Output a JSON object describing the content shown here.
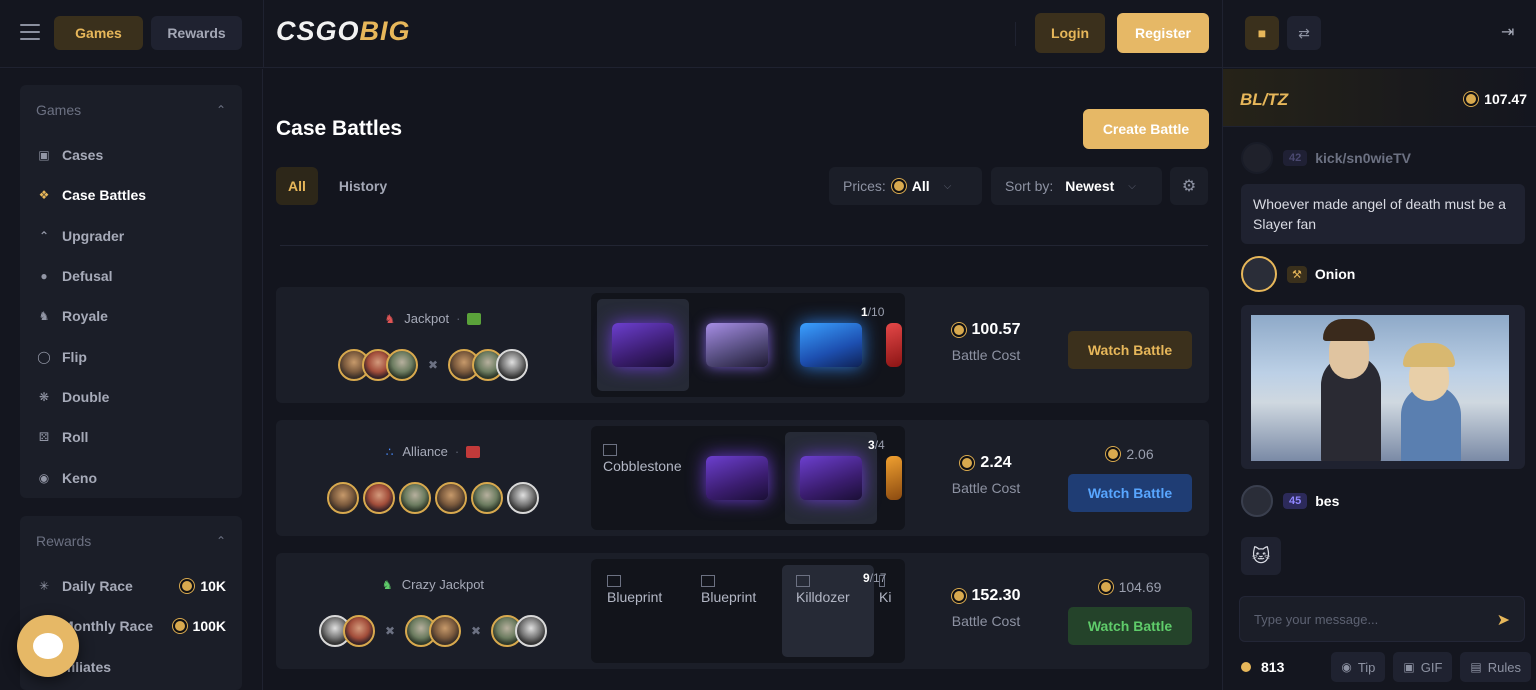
{
  "header": {
    "nav_games": "Games",
    "nav_rewards": "Rewards",
    "logo_main": "CSGO",
    "logo_accent": "BIG",
    "login": "Login",
    "register": "Register"
  },
  "sidebar": {
    "games_title": "Games",
    "games": [
      {
        "label": "Cases",
        "icon": "cases-icon"
      },
      {
        "label": "Case Battles",
        "icon": "case-battles-icon"
      },
      {
        "label": "Upgrader",
        "icon": "upgrader-icon"
      },
      {
        "label": "Defusal",
        "icon": "defusal-icon"
      },
      {
        "label": "Royale",
        "icon": "royale-icon"
      },
      {
        "label": "Flip",
        "icon": "flip-icon"
      },
      {
        "label": "Double",
        "icon": "double-icon"
      },
      {
        "label": "Roll",
        "icon": "roll-icon"
      },
      {
        "label": "Keno",
        "icon": "keno-icon"
      }
    ],
    "rewards_title": "Rewards",
    "rewards": [
      {
        "label": "Daily Race",
        "amount": "10K"
      },
      {
        "label": "Monthly Race",
        "amount": "100K"
      },
      {
        "label": "ffiliates",
        "amount": ""
      }
    ]
  },
  "main": {
    "title": "Case Battles",
    "create_battle": "Create Battle",
    "tabs": [
      "All",
      "History"
    ],
    "prices_label": "Prices:",
    "prices_value": "All",
    "sort_label": "Sort by:",
    "sort_value": "Newest"
  },
  "battles": [
    {
      "mode": "Jackpot",
      "counter_current": "1",
      "counter_total": "/10",
      "cost": "100.57",
      "cost_label": "Battle Cost",
      "watch": "Watch Battle",
      "win_amount": ""
    },
    {
      "mode": "Alliance",
      "case_alt": "Cobblestone",
      "counter_current": "3",
      "counter_total": "/4",
      "cost": "2.24",
      "cost_label": "Battle Cost",
      "watch": "Watch Battle",
      "win_amount": "2.06"
    },
    {
      "mode": "Crazy Jackpot",
      "case_alts": [
        "Blueprint",
        "Blueprint",
        "Killdozer",
        "Ki"
      ],
      "counter_current": "9",
      "counter_total": "/17",
      "cost": "152.30",
      "cost_label": "Battle Cost",
      "watch": "Watch Battle",
      "win_amount": "104.69"
    }
  ],
  "chat": {
    "banner_logo": "BL/TZ",
    "banner_amount": "107.47",
    "messages": [
      {
        "level": "42",
        "user": "kick/sn0wieTV",
        "text": "Whoever made angel of death must be a Slayer fan"
      },
      {
        "user": "Onion"
      },
      {
        "level": "45",
        "user": "bes"
      }
    ],
    "input_placeholder": "Type your message...",
    "online_count": "813",
    "tip": "Tip",
    "gif": "GIF",
    "rules": "Rules"
  },
  "colors": {
    "accent": "#e6b866",
    "background": "#13151e",
    "panel": "#1b1e28",
    "watch_blue": "#58a6ff",
    "watch_green": "#5fcc6a"
  }
}
